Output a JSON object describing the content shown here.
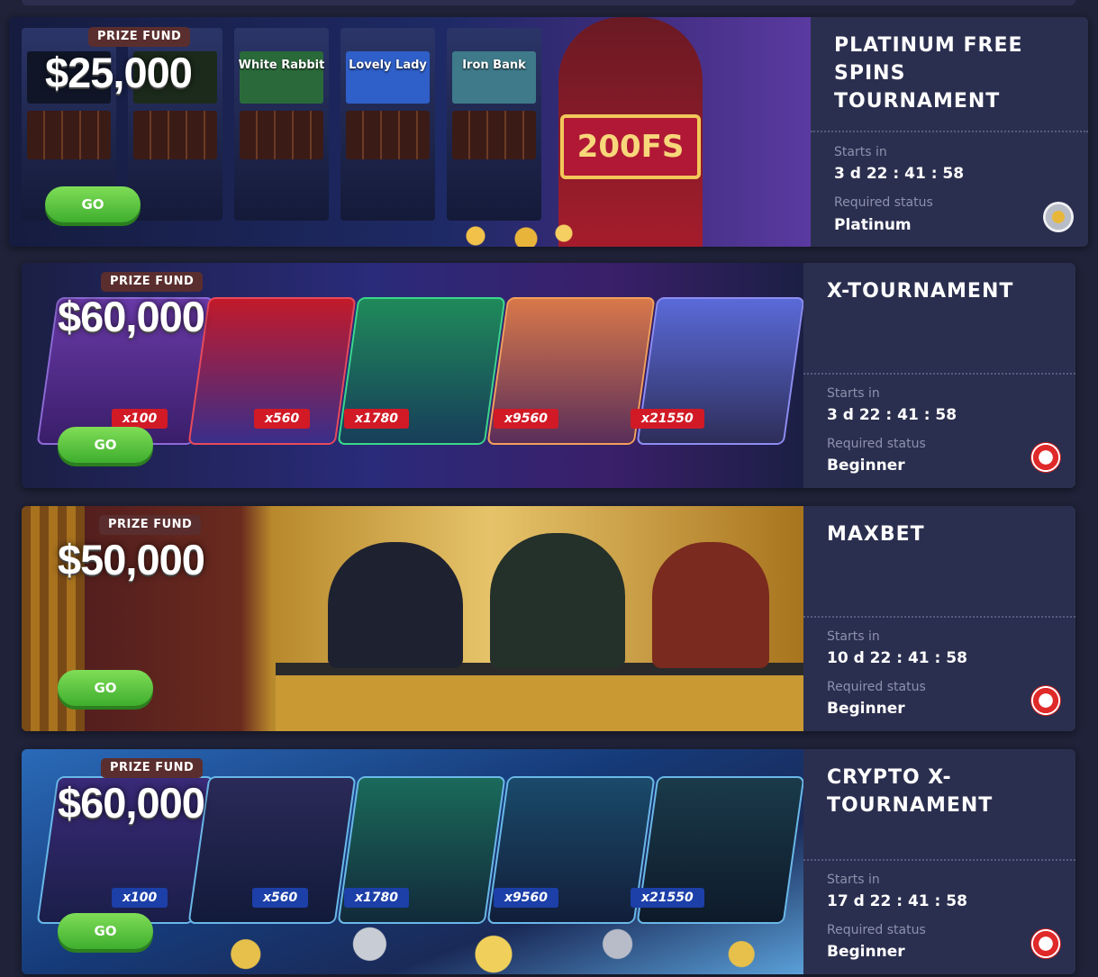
{
  "tournaments": [
    {
      "title": "Platinum Free Spins Tournament",
      "prize_label": "PRIZE FUND",
      "prize_amount": "$25,000",
      "go_label": "GO",
      "starts_label": "Starts in",
      "starts_value": "3 d 22 : 41 : 58",
      "status_label": "Required status",
      "status_value": "Platinum",
      "banner_text": "200FS",
      "slots": [
        "White Rabbit",
        "Lovely Lady",
        "Iron Bank"
      ],
      "badge_icon": "platinum-status-icon"
    },
    {
      "title": "X-Tournament",
      "prize_label": "PRIZE FUND",
      "prize_amount": "$60,000",
      "go_label": "GO",
      "starts_label": "Starts in",
      "starts_value": "3 d 22 : 41 : 58",
      "status_label": "Required status",
      "status_value": "Beginner",
      "multipliers": [
        "x100",
        "x560",
        "x1780",
        "x9560",
        "x21550"
      ],
      "badge_icon": "beginner-status-icon"
    },
    {
      "title": "Maxbet",
      "prize_label": "PRIZE FUND",
      "prize_amount": "$50,000",
      "go_label": "GO",
      "starts_label": "Starts in",
      "starts_value": "10 d 22 : 41 : 58",
      "status_label": "Required status",
      "status_value": "Beginner",
      "badge_icon": "beginner-status-icon"
    },
    {
      "title": "Crypto X-Tournament",
      "prize_label": "PRIZE FUND",
      "prize_amount": "$60,000",
      "go_label": "GO",
      "starts_label": "Starts in",
      "starts_value": "17 d 22 : 41 : 58",
      "status_label": "Required status",
      "status_value": "Beginner",
      "multipliers": [
        "x100",
        "x560",
        "x1780",
        "x9560",
        "x21550"
      ],
      "badge_icon": "beginner-status-icon"
    }
  ]
}
